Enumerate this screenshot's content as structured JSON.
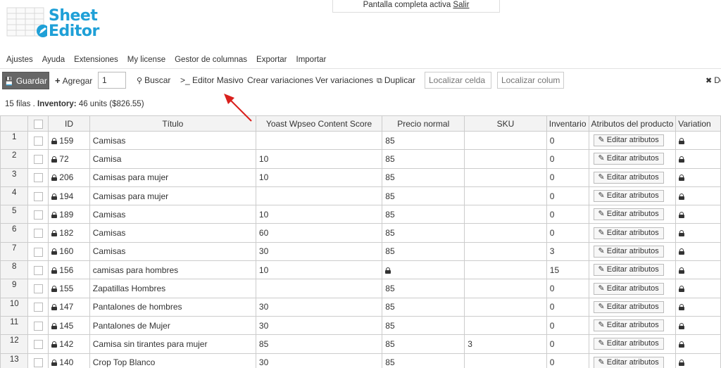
{
  "banner": {
    "text": "Pantalla completa activa",
    "exit_label": "Salir"
  },
  "logo": {
    "line1": "Sheet",
    "line2": "Editor"
  },
  "menu": [
    "Ajustes",
    "Ayuda",
    "Extensiones",
    "My license",
    "Gestor de columnas",
    "Exportar",
    "Importar"
  ],
  "toolbar": {
    "save_label": "Guardar",
    "add_label": "Agregar",
    "quantity_value": "1",
    "search_label": "Buscar",
    "bulk_label": ">_ Editor Masivo",
    "create_variations_label": "Crear variaciones",
    "view_variations_label": "Ver variaciones",
    "duplicate_label": "Duplicar",
    "locate_cell_placeholder": "Localizar celda",
    "locate_column_placeholder": "Localizar columna",
    "close_label": "De"
  },
  "summary": {
    "rows_text": "15 filas . ",
    "inventory_label": "Inventory:",
    "inventory_value": " 46 units ($826.55)"
  },
  "columns": [
    "ID",
    "Título",
    "Yoast Wpseo Content Score",
    "Precio normal",
    "SKU",
    "Inventario",
    "Atributos del producto",
    "Variation"
  ],
  "edit_attributes_label": "Editar atributos",
  "rows": [
    {
      "n": "1",
      "id": "159",
      "title": "Camisas",
      "score": "",
      "price": "85",
      "sku": "",
      "inventory": "0"
    },
    {
      "n": "2",
      "id": "72",
      "title": "Camisa",
      "score": "10",
      "price": "85",
      "sku": "",
      "inventory": "0"
    },
    {
      "n": "3",
      "id": "206",
      "title": "Camisas para mujer",
      "score": "10",
      "price": "85",
      "sku": "",
      "inventory": "0"
    },
    {
      "n": "4",
      "id": "194",
      "title": "Camisas para mujer",
      "score": "",
      "price": "85",
      "sku": "",
      "inventory": "0"
    },
    {
      "n": "5",
      "id": "189",
      "title": "Camisas",
      "score": "10",
      "price": "85",
      "sku": "",
      "inventory": "0"
    },
    {
      "n": "6",
      "id": "182",
      "title": "Camisas",
      "score": "60",
      "price": "85",
      "sku": "",
      "inventory": "0"
    },
    {
      "n": "7",
      "id": "160",
      "title": "Camisas",
      "score": "30",
      "price": "85",
      "sku": "",
      "inventory": "3"
    },
    {
      "n": "8",
      "id": "156",
      "title": "camisas para hombres",
      "score": "10",
      "price": "",
      "price_locked": true,
      "sku": "",
      "inventory": "15"
    },
    {
      "n": "9",
      "id": "155",
      "title": "Zapatillas Hombres",
      "score": "",
      "price": "85",
      "sku": "",
      "inventory": "0"
    },
    {
      "n": "10",
      "id": "147",
      "title": "Pantalones de hombres",
      "score": "30",
      "price": "85",
      "sku": "",
      "inventory": "0"
    },
    {
      "n": "11",
      "id": "145",
      "title": "Pantalones de Mujer",
      "score": "30",
      "price": "85",
      "sku": "",
      "inventory": "0"
    },
    {
      "n": "12",
      "id": "142",
      "title": "Camisa sin tirantes para mujer",
      "score": "85",
      "price": "85",
      "sku": "3",
      "inventory": "0"
    },
    {
      "n": "13",
      "id": "140",
      "title": "Crop Top Blanco",
      "score": "30",
      "price": "85",
      "sku": "",
      "inventory": "0"
    }
  ],
  "colors": {
    "save_bg": "#666666",
    "logo_blue": "#1fa0d7",
    "arrow_red": "#d9201d"
  }
}
